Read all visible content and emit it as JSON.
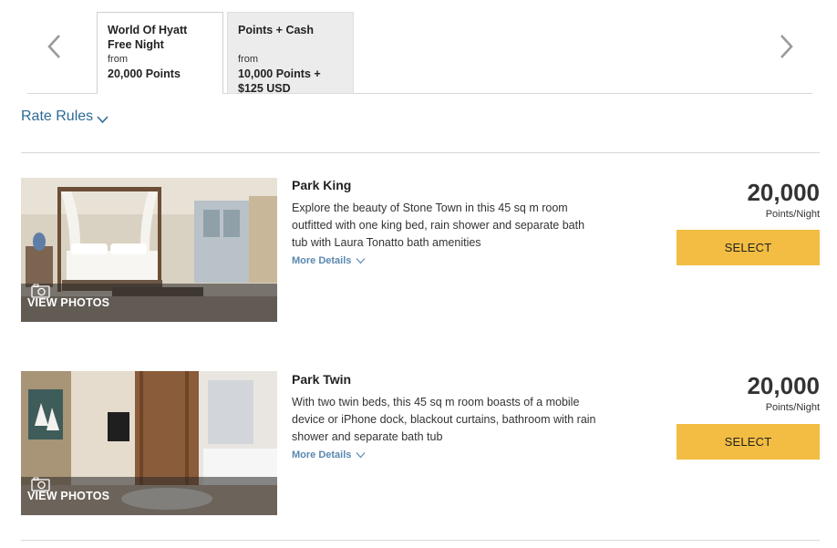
{
  "rate_tabs": [
    {
      "title": "World Of Hyatt Free Night",
      "from_label": "from",
      "price": "20,000 Points"
    },
    {
      "title": "Points + Cash",
      "from_label": "from",
      "price": "10,000 Points + $125 USD"
    }
  ],
  "rate_rules": {
    "label": "Rate Rules"
  },
  "rooms": [
    {
      "name": "Park King",
      "description": "Explore the beauty of Stone Town in this 45 sq m room outfitted with one king bed, rain shower and separate bath tub with Laura Tonatto bath amenities",
      "more_details": "More Details",
      "view_photos": "VIEW PHOTOS",
      "points": "20,000",
      "points_unit": "Points/Night",
      "select_label": "SELECT"
    },
    {
      "name": "Park Twin",
      "description": "With two twin beds, this 45 sq m room boasts of a mobile device or iPhone dock, blackout curtains, bathroom with rain shower and separate bath tub",
      "more_details": "More Details",
      "view_photos": "VIEW PHOTOS",
      "points": "20,000",
      "points_unit": "Points/Night",
      "select_label": "SELECT"
    }
  ],
  "colors": {
    "accent_button": "#f2bd42",
    "link": "#2d6a96",
    "selected_tab_bg": "#ffffff",
    "inactive_tab_bg": "#ececec"
  }
}
